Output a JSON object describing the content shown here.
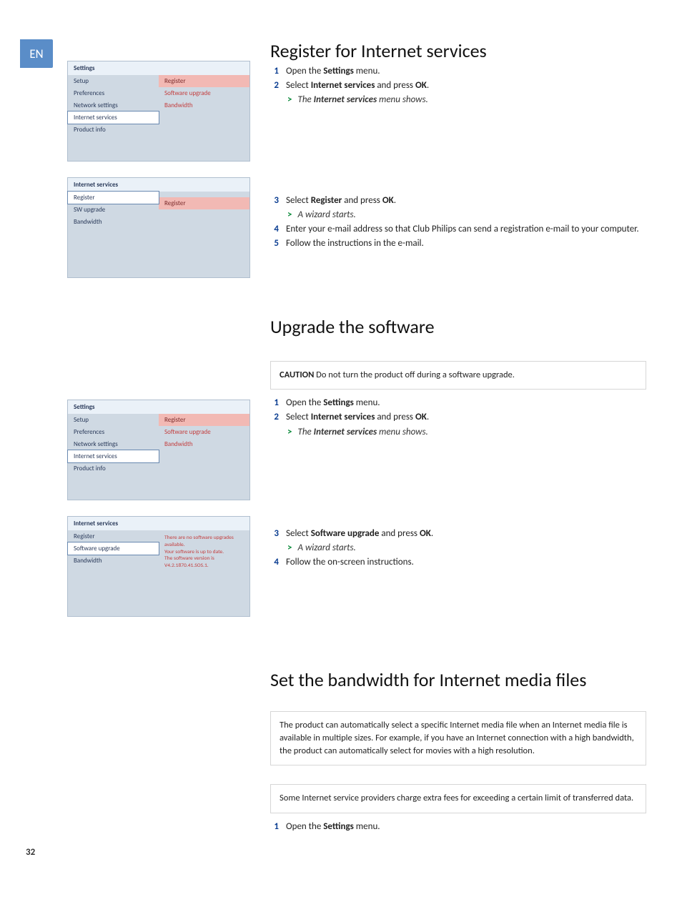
{
  "lang": "EN",
  "page_number": "32",
  "menu1": {
    "title": "Settings",
    "left": [
      "Setup",
      "Preferences",
      "Network settings",
      "Internet services",
      "Product info"
    ],
    "selected_index": 3,
    "right": [
      "Register",
      "Software upgrade",
      "Bandwidth"
    ],
    "highlight_index": 0
  },
  "menu2": {
    "title": "Internet services",
    "left": [
      "Register",
      "SW upgrade",
      "Bandwidth"
    ],
    "selected_index": 0,
    "right_highlight": "Register"
  },
  "menu3": {
    "title": "Settings",
    "left": [
      "Setup",
      "Preferences",
      "Network settings",
      "Internet services",
      "Product info"
    ],
    "selected_index": 3,
    "right": [
      "Register",
      "Software upgrade",
      "Bandwidth"
    ],
    "highlight_index": 0
  },
  "menu4": {
    "title": "Internet services",
    "left": [
      "Register",
      "Software upgrade",
      "Bandwidth"
    ],
    "selected_index": 1,
    "info_text": "There are no software upgrades available.\nYour software is up to date.\nThe software version is V4.2.1870.41.SOS.1."
  },
  "section1": {
    "heading": "Register for Internet services",
    "steps_a": {
      "1": {
        "pre": "Open the ",
        "bold": "Settings",
        "post": " menu."
      },
      "2": {
        "pre": "Select ",
        "bold1": "Internet services",
        "mid": " and press ",
        "bold2": "OK",
        "post": "."
      },
      "sub2": {
        "pre": "The ",
        "bold": "Internet services",
        "post": " menu shows."
      }
    },
    "steps_b": {
      "3": {
        "pre": "Select ",
        "bold1": "Register",
        "mid": " and press ",
        "bold2": "OK",
        "post": "."
      },
      "sub3": "A wizard starts.",
      "4": "Enter your e-mail address so that Club Philips can send a registration e-mail to your computer.",
      "5": "Follow the instructions in the e-mail."
    }
  },
  "section2": {
    "heading": "Upgrade the software",
    "caution_label": "CAUTION",
    "caution_text": " Do not turn the product off during a software upgrade.",
    "steps_a": {
      "1": {
        "pre": "Open the ",
        "bold": "Settings",
        "post": " menu."
      },
      "2": {
        "pre": "Select ",
        "bold1": "Internet services",
        "mid": " and press ",
        "bold2": "OK",
        "post": "."
      },
      "sub2": {
        "pre": "The ",
        "bold": "Internet services",
        "post": " menu shows."
      }
    },
    "steps_b": {
      "3": {
        "pre": "Select ",
        "bold1": "Software upgrade",
        "mid": " and press ",
        "bold2": "OK",
        "post": "."
      },
      "sub3": "A wizard starts.",
      "4": "Follow the on-screen instructions."
    }
  },
  "section3": {
    "heading": "Set the bandwidth for Internet media files",
    "info1": "The product can automatically select a specific Internet media file when an Internet media file is available in multiple sizes. For example, if you have an Internet connection with a high bandwidth, the product can automatically select for movies with a high resolution.",
    "info2": "Some Internet service providers charge extra fees for exceeding a certain limit of transferred data.",
    "step1": {
      "pre": "Open the ",
      "bold": "Settings",
      "post": " menu."
    }
  }
}
